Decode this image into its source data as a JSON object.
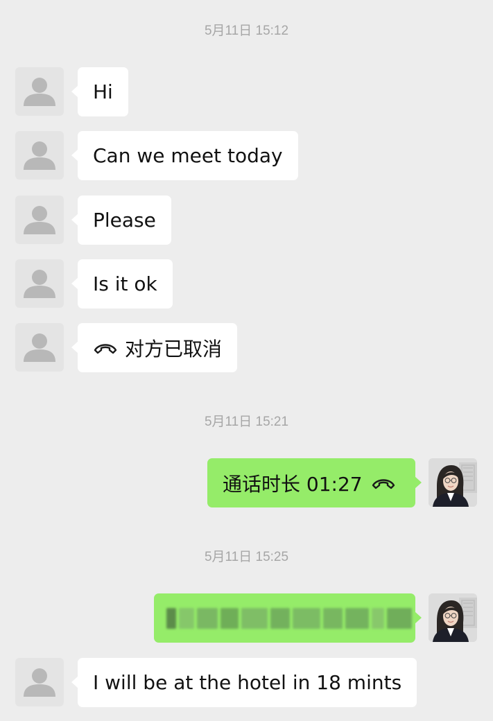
{
  "timestamps": [
    "5月11日 15:12",
    "5月11日 15:21",
    "5月11日 15:25"
  ],
  "messages": [
    {
      "side": "left",
      "text": "Hi"
    },
    {
      "side": "left",
      "text": "Can we meet today"
    },
    {
      "side": "left",
      "text": "Please"
    },
    {
      "side": "left",
      "text": "Is it ok"
    },
    {
      "side": "left",
      "text": "对方已取消",
      "icon": "phone-hangup-icon"
    },
    {
      "side": "right",
      "text": "通话时长 01:27",
      "icon": "phone-hangup-icon"
    },
    {
      "side": "right",
      "text": "",
      "note": "redacted"
    },
    {
      "side": "left",
      "text": "I will be at the hotel in 18 mints"
    }
  ],
  "colors": {
    "background": "#ededed",
    "incoming_bubble": "#ffffff",
    "outgoing_bubble": "#95ec69",
    "timestamp_text": "#a6a6a6"
  }
}
